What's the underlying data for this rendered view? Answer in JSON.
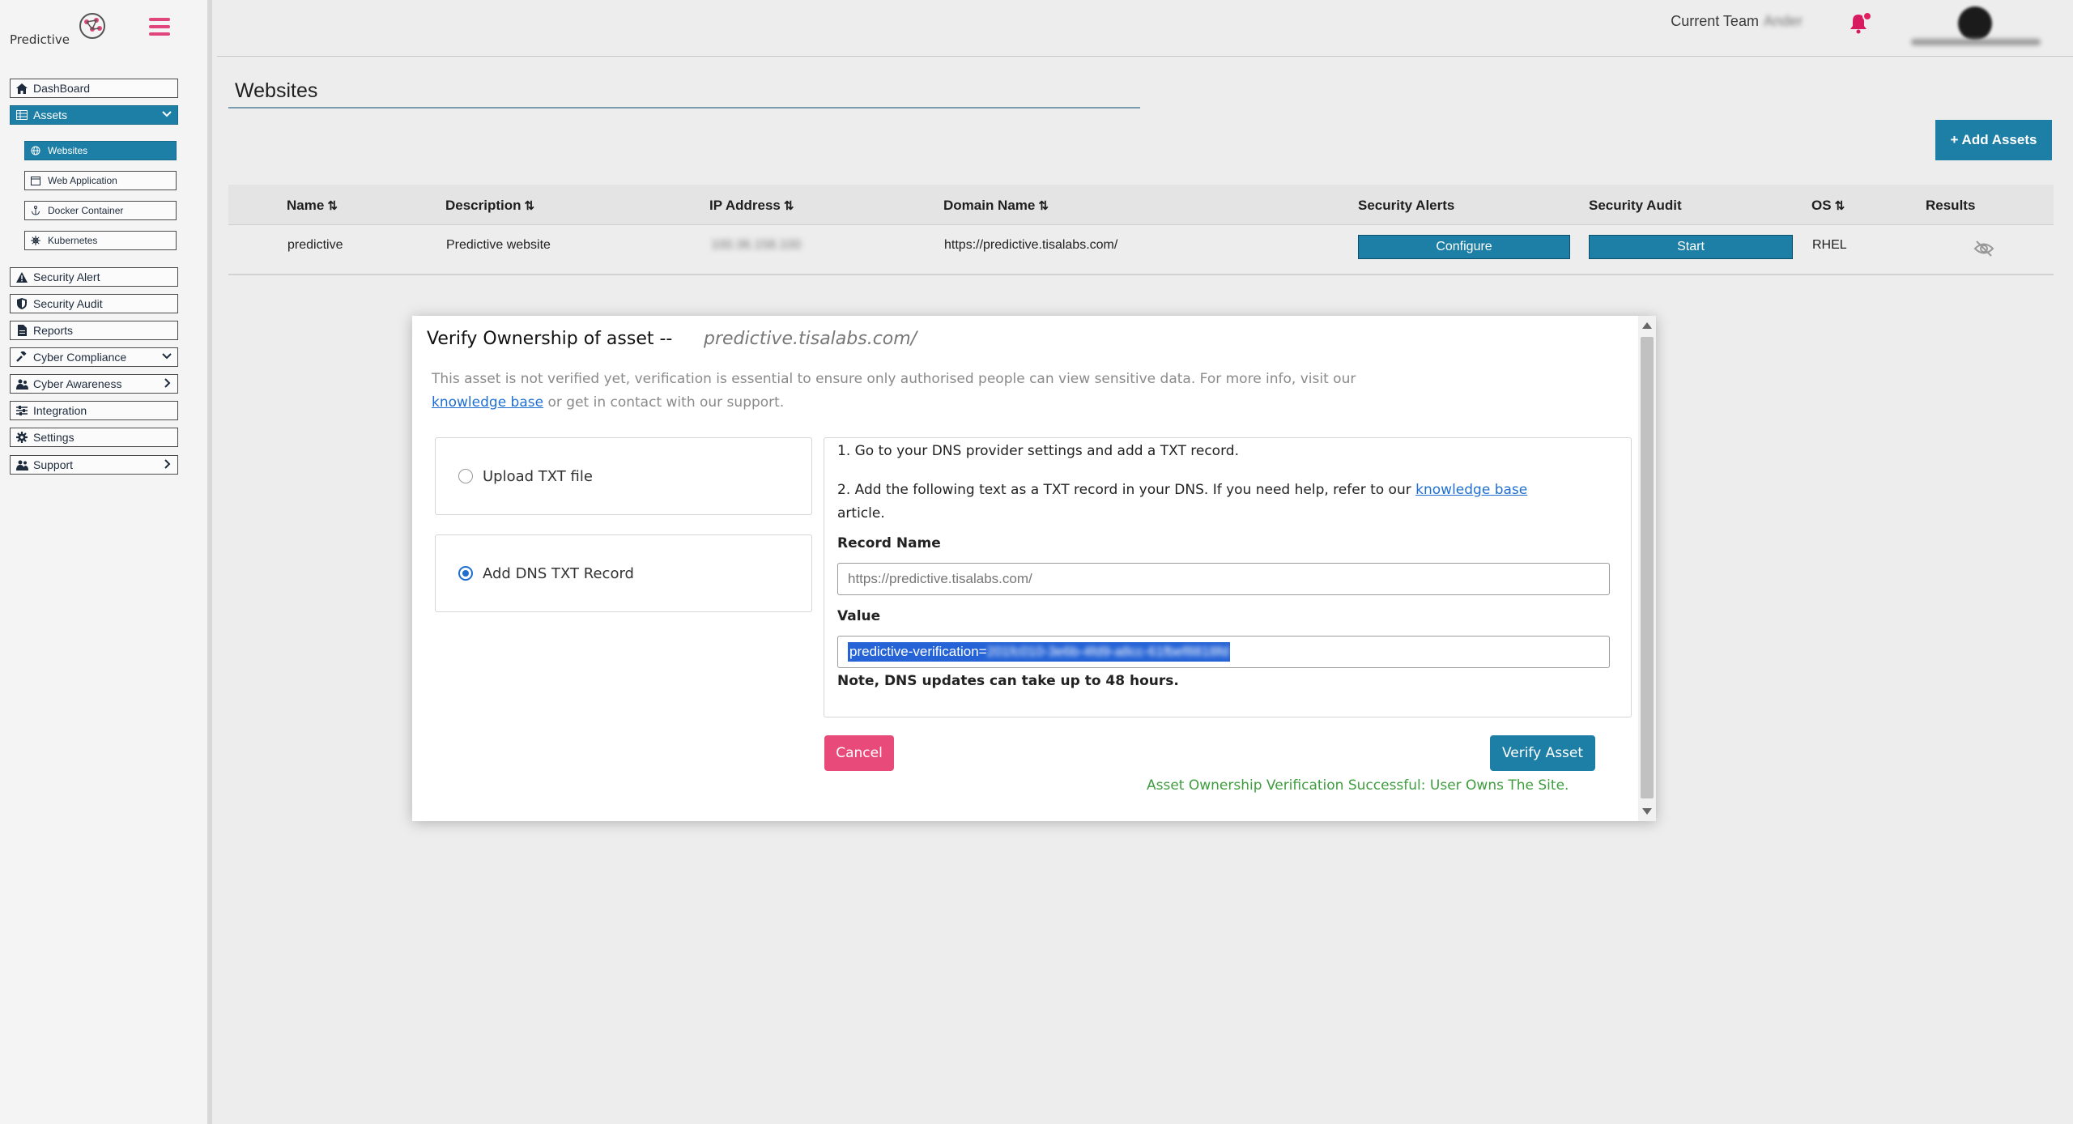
{
  "brand": {
    "name": "Predictive"
  },
  "sidebar": {
    "items": [
      {
        "label": "DashBoard",
        "icon": "home-icon"
      },
      {
        "label": "Assets",
        "icon": "table-icon"
      },
      {
        "label": "Security Alert",
        "icon": "warning-icon"
      },
      {
        "label": "Security Audit",
        "icon": "shield-icon"
      },
      {
        "label": "Reports",
        "icon": "file-icon"
      },
      {
        "label": "Cyber Compliance",
        "icon": "gavel-icon"
      },
      {
        "label": "Cyber Awareness",
        "icon": "users-icon"
      },
      {
        "label": "Integration",
        "icon": "sliders-icon"
      },
      {
        "label": "Settings",
        "icon": "gear-icon"
      },
      {
        "label": "Support",
        "icon": "support-icon"
      }
    ],
    "sub_items": [
      {
        "label": "Websites",
        "icon": "globe-icon"
      },
      {
        "label": "Web Application",
        "icon": "window-icon"
      },
      {
        "label": "Docker Container",
        "icon": "anchor-icon"
      },
      {
        "label": "Kubernetes",
        "icon": "helm-icon"
      }
    ]
  },
  "header": {
    "team_label": "Current Team",
    "team_name": "Ander",
    "notification_count": "1"
  },
  "main": {
    "title": "Websites",
    "add_button": "+ Add Assets",
    "table": {
      "columns": [
        "Name",
        "Description",
        "IP Address",
        "Domain Name",
        "Security Alerts",
        "Security Audit",
        "OS",
        "Results"
      ],
      "rows": [
        {
          "name": "predictive",
          "description": "Predictive website",
          "ip": "100.36.158.100",
          "domain": "https://predictive.tisalabs.com/",
          "alerts_button": "Configure",
          "audit_button": "Start",
          "os": "RHEL"
        }
      ]
    }
  },
  "modal": {
    "title": "Verify Ownership of asset --",
    "domain": "predictive.tisalabs.com/",
    "info_before": "This asset is not verified yet, verification is essential to ensure only authorised people can view sensitive data. For more info, visit our",
    "info_link": "knowledge base",
    "info_after": "or get in contact with our support.",
    "option_upload": "Upload TXT file",
    "option_dns": "Add DNS TXT Record",
    "step1": "1. Go to your DNS provider settings and add a TXT record.",
    "step2_before": "2. Add the following text as a TXT record in your DNS. If you need help, refer to our",
    "step2_link": "knowledge base",
    "step2_after": "article.",
    "record_name_label": "Record Name",
    "record_name_value": "https://predictive.tisalabs.com/",
    "value_label": "Value",
    "value_prefix": "predictive-verification=",
    "value_hidden": "201fc010-3e6b-4fd9-a8cc-61fbef8818fd",
    "note": "Note, DNS updates can take up to 48 hours.",
    "cancel": "Cancel",
    "verify": "Verify Asset",
    "success": "Asset Ownership Verification Successful: User Owns The Site."
  },
  "colors": {
    "accent": "#1e7fa6",
    "cancel": "#e84a7a",
    "success": "#3f9d3f",
    "link": "#1f6fd1"
  }
}
